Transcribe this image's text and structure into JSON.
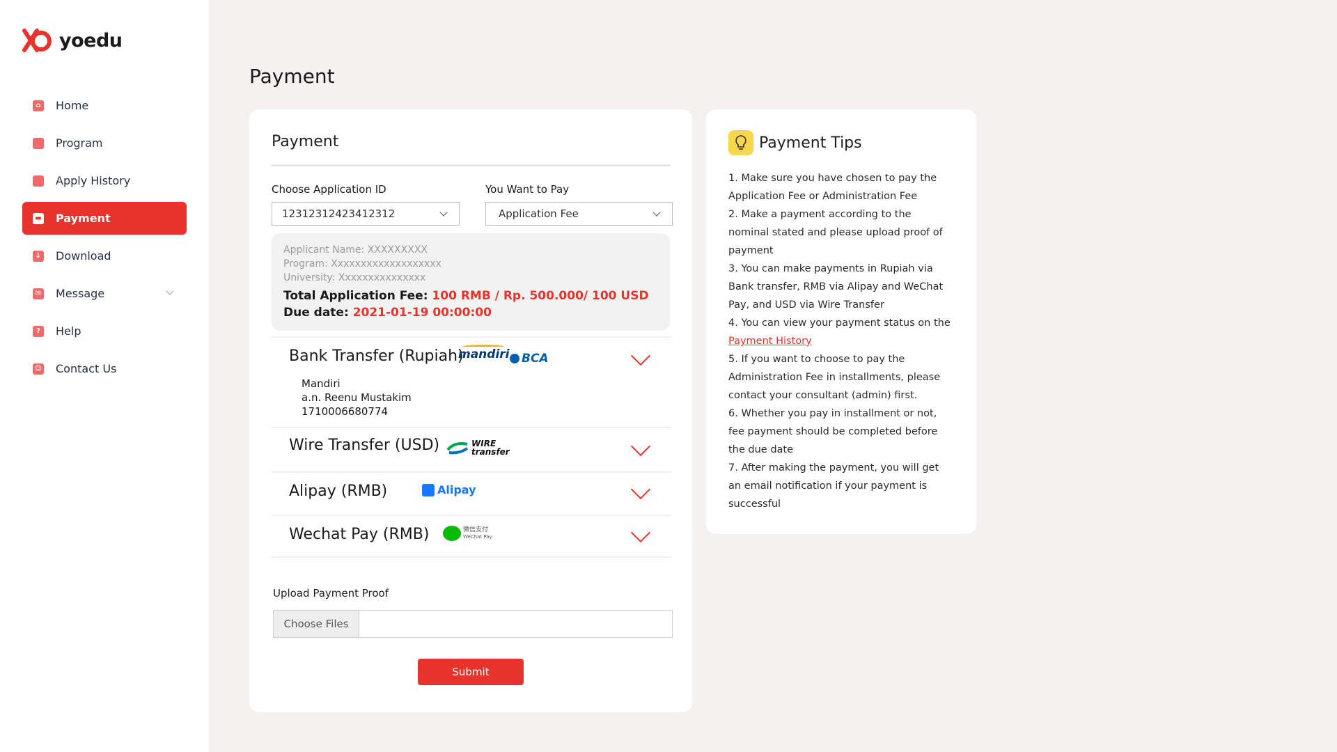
{
  "app": {
    "brand": "yoedu",
    "accent": "#e8332d"
  },
  "sidebar": {
    "items": [
      {
        "label": "Home",
        "icon": "home-icon"
      },
      {
        "label": "Program",
        "icon": "briefcase-icon"
      },
      {
        "label": "Apply History",
        "icon": "folder-icon"
      },
      {
        "label": "Payment",
        "icon": "credit-card-icon",
        "active": true
      },
      {
        "label": "Download",
        "icon": "download-icon"
      },
      {
        "label": "Message",
        "icon": "mail-icon",
        "has_submenu": true
      },
      {
        "label": "Help",
        "icon": "question-icon"
      },
      {
        "label": "Contact Us",
        "icon": "contact-book-icon"
      }
    ]
  },
  "page": {
    "title": "Payment"
  },
  "payment": {
    "card_title": "Payment",
    "application_id_label": "Choose Application ID",
    "application_id_value": "12312312423412312",
    "pay_label": "You Want to Pay",
    "pay_value": "Application Fee",
    "applicant_name": "Applicant Name: XXXXXXXXX",
    "program": "Program: Xxxxxxxxxxxxxxxxxxx",
    "university": "University: Xxxxxxxxxxxxxxx",
    "total_fee_label": "Total Application Fee:",
    "total_fee_value": "100 RMB / Rp. 500.000/ 100 USD",
    "due_date_label": "Due date:",
    "due_date_value": "2021-01-19 00:00:00",
    "methods": [
      {
        "title": "Bank Transfer (Rupiah)",
        "logos": [
          "mandiri",
          "BCA"
        ],
        "expanded": true,
        "details": [
          "Mandiri",
          "a.n. Reenu Mustakim",
          "1710006680774"
        ]
      },
      {
        "title": "Wire Transfer (USD)",
        "logos": [
          "WIRE",
          "transfer"
        ]
      },
      {
        "title": "Alipay (RMB)",
        "logos": [
          "Alipay"
        ]
      },
      {
        "title": "Wechat Pay (RMB)",
        "logos": [
          "微信支付",
          "WeChat Pay"
        ]
      }
    ],
    "upload_label": "Upload Payment Proof",
    "choose_files_label": "Choose Files",
    "submit_label": "Submit"
  },
  "tips": {
    "title": "Payment Tips",
    "items": [
      "1. Make sure you have chosen to pay the Application Fee or Administration Fee",
      "2. Make a payment according to the nominal stated and please upload proof of payment",
      "3. You can make payments in Rupiah via Bank transfer, RMB via Alipay and WeChat Pay, and USD via Wire Transfer",
      "4. You can view your payment status on the",
      "5. If you want to choose to pay the Administration Fee in installments, please contact your consultant (admin) first.",
      "6. Whether you pay in installment or not, fee payment should be completed before the due date",
      "7. After making the payment, you will get an email notification if your payment is successful"
    ],
    "history_link": "Payment History "
  }
}
